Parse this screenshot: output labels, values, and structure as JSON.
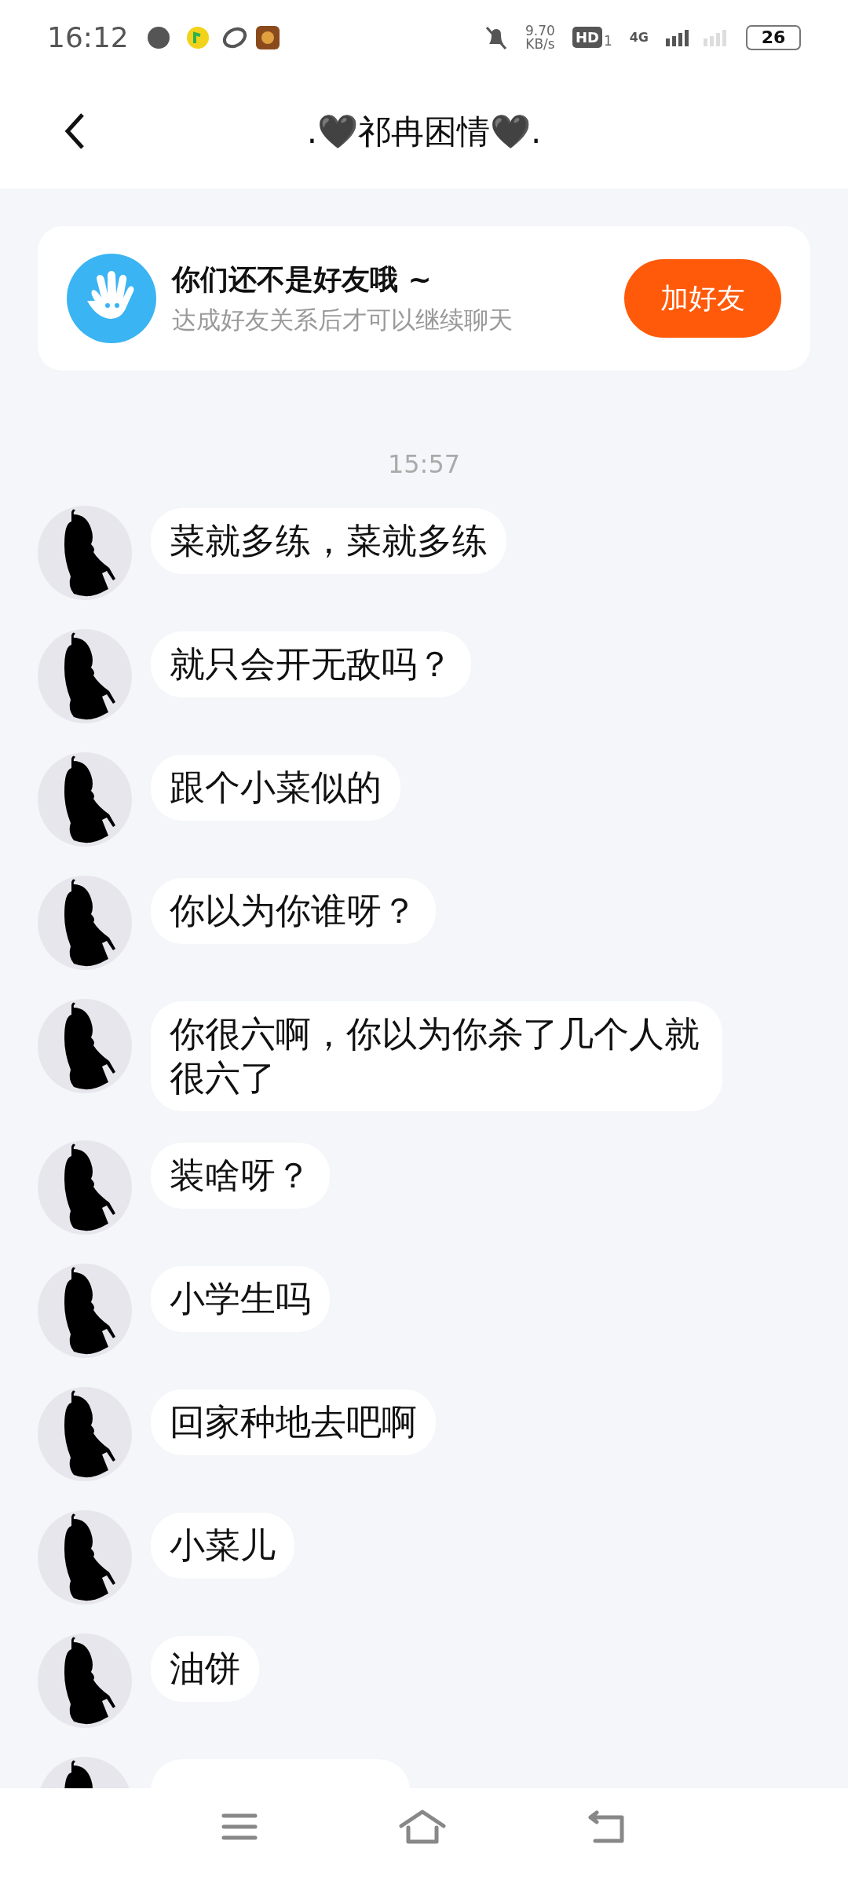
{
  "status_bar": {
    "time": "16:12",
    "speed_value": "9.70",
    "speed_unit": "KB/s",
    "hd": "HD",
    "hd_sub": "1",
    "network": "4G",
    "battery": "26"
  },
  "header": {
    "title": ".🖤祁冉困情🖤."
  },
  "friend_banner": {
    "title": "你们还不是好友哦 ~",
    "subtitle": "达成好友关系后才可以继续聊天",
    "button": "加好友"
  },
  "time_divider": "15:57",
  "messages": [
    {
      "text": "菜就多练，菜就多练"
    },
    {
      "text": "就只会开无敌吗？"
    },
    {
      "text": "跟个小菜似的"
    },
    {
      "text": "你以为你谁呀？"
    },
    {
      "text": "你很六啊，你以为你杀了几个人就很六了"
    },
    {
      "text": "装啥呀？"
    },
    {
      "text": "小学生吗"
    },
    {
      "text": "回家种地去吧啊"
    },
    {
      "text": "小菜儿"
    },
    {
      "text": "油饼"
    }
  ],
  "cut_off_row": {
    "kind": "message"
  }
}
